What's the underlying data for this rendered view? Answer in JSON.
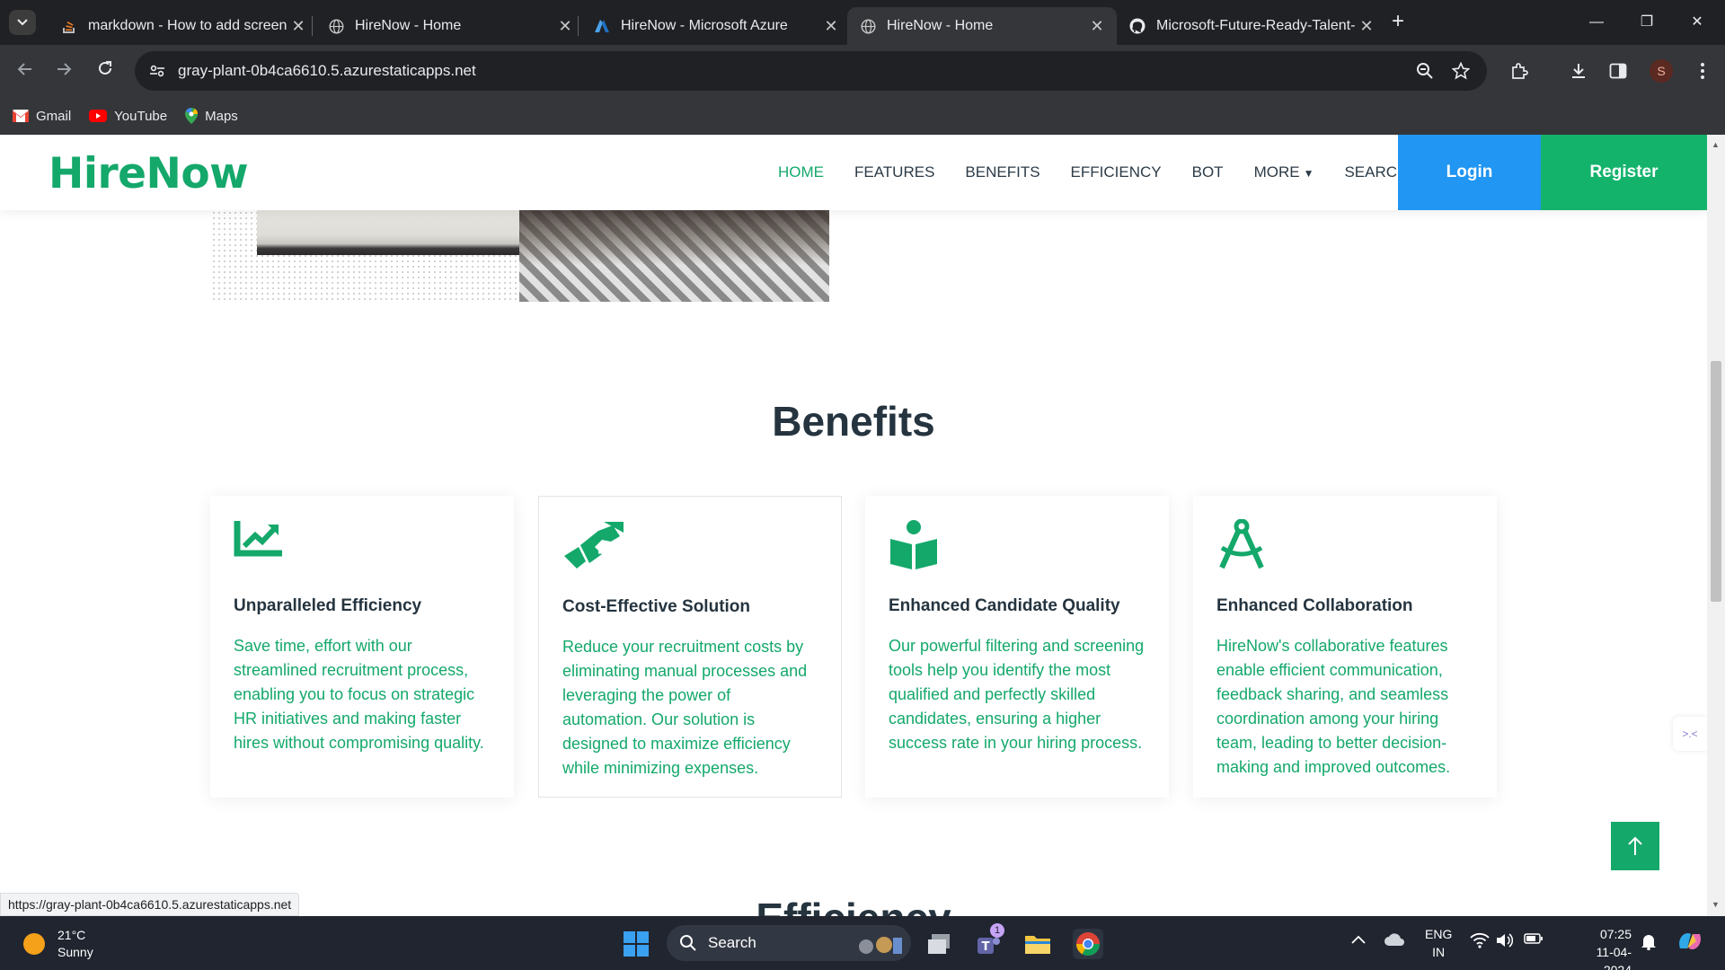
{
  "browser": {
    "tabs": [
      {
        "title": "markdown - How to add screen",
        "icon": "stackoverflow-icon"
      },
      {
        "title": "HireNow - Home",
        "icon": "globe-icon"
      },
      {
        "title": "HireNow - Microsoft Azure",
        "icon": "azure-icon"
      },
      {
        "title": "HireNow - Home",
        "icon": "globe-icon",
        "active": true
      },
      {
        "title": "Microsoft-Future-Ready-Talent-",
        "icon": "github-icon"
      }
    ],
    "url": "gray-plant-0b4ca6610.5.azurestaticapps.net",
    "profile_initial": "S",
    "bookmarks": [
      {
        "label": "Gmail",
        "icon": "gmail-icon"
      },
      {
        "label": "YouTube",
        "icon": "youtube-icon"
      },
      {
        "label": "Maps",
        "icon": "maps-icon"
      }
    ],
    "status_url": "https://gray-plant-0b4ca6610.5.azurestaticapps.net"
  },
  "site": {
    "logo": "HireNow",
    "nav": [
      "HOME",
      "FEATURES",
      "BENEFITS",
      "EFFICIENCY",
      "BOT",
      "MORE",
      "SEARCH"
    ],
    "active_nav": "HOME",
    "login": "Login",
    "register": "Register",
    "brand_color": "#14a86b",
    "login_color": "#2196f3"
  },
  "benefits": {
    "title": "Benefits",
    "cards": [
      {
        "icon": "chart-line-icon",
        "title": "Unparalleled Efficiency",
        "text": "Save time, effort with our streamlined recruitment process, enabling you to focus on strategic HR initiatives and making faster hires without compromising quality."
      },
      {
        "icon": "handshake-icon",
        "title": "Cost-Effective Solution",
        "text": "Reduce your recruitment costs by eliminating manual processes and leveraging the power of automation. Our solution is designed to maximize efficiency while minimizing expenses."
      },
      {
        "icon": "book-reader-icon",
        "title": "Enhanced Candidate Quality",
        "text": "Our powerful filtering and screening tools help you identify the most qualified and perfectly skilled candidates, ensuring a higher success rate in your hiring process."
      },
      {
        "icon": "compass-drafting-icon",
        "title": "Enhanced Collaboration",
        "text": "HireNow's collaborative features enable efficient communication, feedback sharing, and seamless coordination among your hiring team, leading to better decision-making and improved outcomes."
      }
    ]
  },
  "next_section_title": "Efficiency",
  "taskbar": {
    "temperature": "21°C",
    "weather": "Sunny",
    "search_placeholder": "Search",
    "teams_badge": "1",
    "lang_top": "ENG",
    "lang_bottom": "IN",
    "time": "07:25",
    "date": "11-04-2024"
  }
}
